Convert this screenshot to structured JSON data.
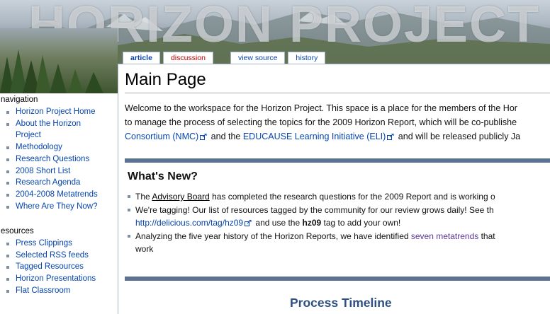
{
  "banner": {
    "logo_text": "HORIZON PROJECT"
  },
  "tabs": [
    {
      "label": "article"
    },
    {
      "label": "discussion"
    },
    {
      "label": "view source"
    },
    {
      "label": "history"
    }
  ],
  "page": {
    "title": "Main Page",
    "intro": {
      "line1": "Welcome to the workspace for the Horizon Project. This space is a place for the members of the Hor",
      "line2": "to manage the process of selecting the topics for the 2009 Horizon Report, which will be co-publishe",
      "line3_link1": "Consortium (NMC)",
      "line3_mid": " and the ",
      "line3_link2": "EDUCAUSE Learning Initiative (ELI)",
      "line3_end": " and will be released publicly Ja"
    },
    "whats_new": {
      "title": "What's New?",
      "item1_pre": "The ",
      "item1_link": "Advisory Board",
      "item1_post": " has completed the research questions for the 2009 Report and is working o",
      "item2_text": "We're tagging! Our list of resources tagged by the community for our review grows daily! See th",
      "item2_link": "http://delicious.com/tag/hz09",
      "item2_mid": " and use the ",
      "item2_bold": "hz09",
      "item2_end": " tag to add your own!",
      "item3_pre": "Analyzing the five year history of the Horizon Reports, we have identified ",
      "item3_link": "seven metatrends",
      "item3_post": " that",
      "item3_cont": "work"
    },
    "process_timeline": "Process Timeline"
  },
  "sidebar": {
    "navigation_heading": "navigation",
    "navigation_items": [
      "Horizon Project Home",
      "About the Horizon",
      "Project",
      "Methodology",
      "Research Questions",
      "2008 Short List",
      "Research Agenda",
      "2004-2008 Metatrends",
      "Where Are They Now?"
    ],
    "resources_heading": "esources",
    "resources_items": [
      "Press Clippings",
      "Selected RSS feeds",
      "Tagged Resources",
      "Horizon Presentations",
      "Flat Classroom"
    ]
  },
  "colors": {
    "link": "#0645ad",
    "visited": "#5a3696",
    "band": "#5b7391",
    "timeline": "#2f4f80"
  }
}
